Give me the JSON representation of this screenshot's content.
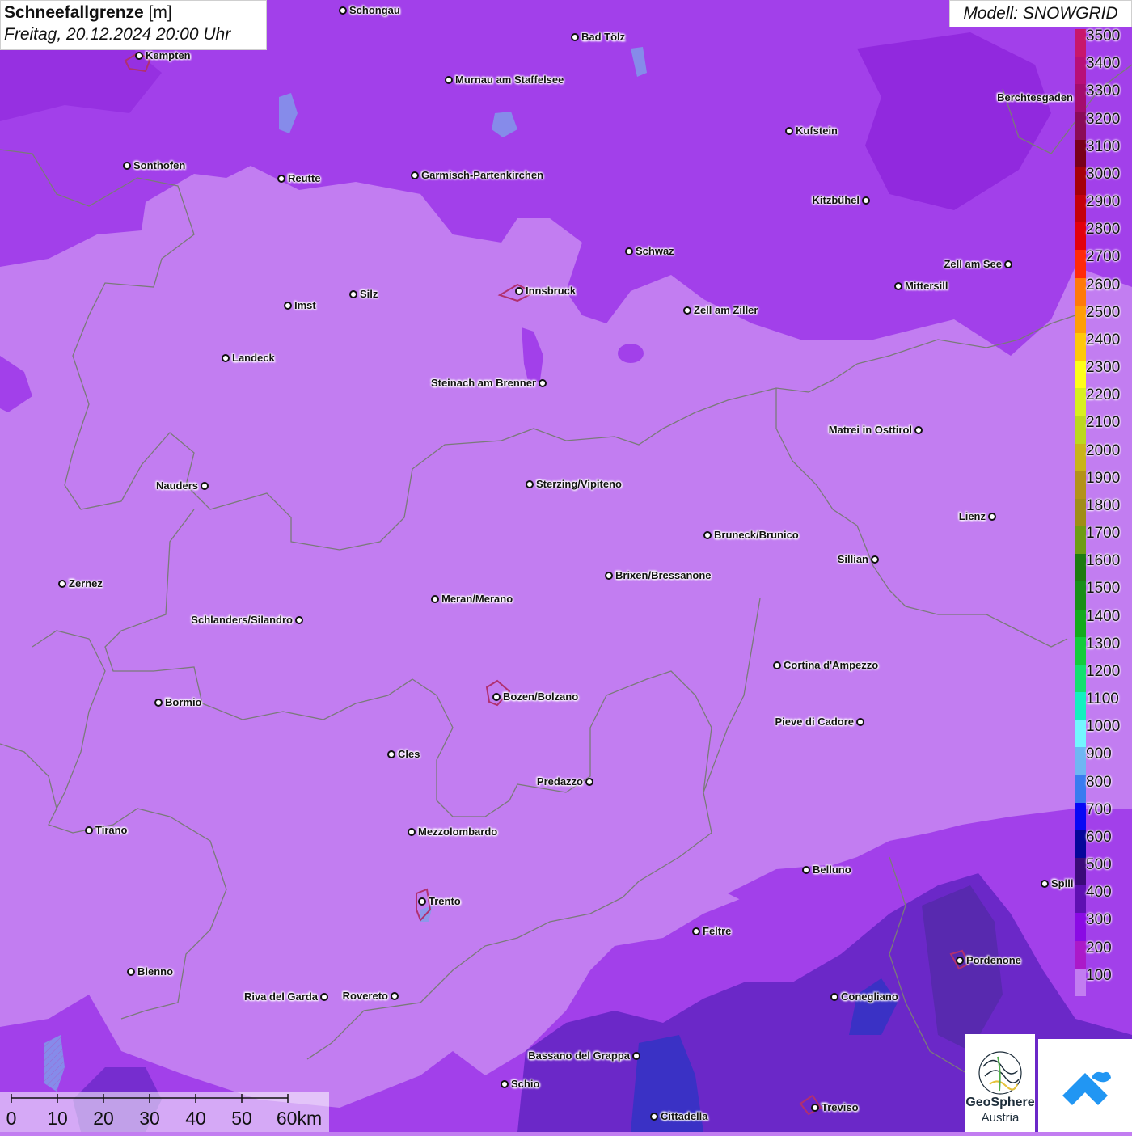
{
  "title": {
    "main": "Schneefallgrenze",
    "unit": "[m]",
    "datetime": "Freitag, 20.12.2024 20:00 Uhr"
  },
  "model_label": "Modell: SNOWGRID",
  "colors": {
    "light_purple": "#c27df1",
    "mid_purple": "#a240ea",
    "dark_purple": "#8a1fd8",
    "blue_purple": "#6b28c8",
    "deep_blue": "#3a31c5",
    "border_gray": "#7a7a7a",
    "lake_blue": "#7f9dea"
  },
  "legend": {
    "labels": [
      "3500",
      "3400",
      "3300",
      "3200",
      "3100",
      "3000",
      "2900",
      "2800",
      "2700",
      "2600",
      "2500",
      "2400",
      "2300",
      "2200",
      "2100",
      "2000",
      "1900",
      "1800",
      "1700",
      "1600",
      "1500",
      "1400",
      "1300",
      "1200",
      "1100",
      "1000",
      "900",
      "800",
      "700",
      "600",
      "500",
      "400",
      "300",
      "200",
      "100"
    ],
    "colors": [
      "#c8176b",
      "#b80f78",
      "#a40c6e",
      "#8a0b58",
      "#78001a",
      "#a5000a",
      "#c4000c",
      "#e2000e",
      "#ff2a0a",
      "#ff7a0a",
      "#ff9e08",
      "#ffc80a",
      "#ffff1a",
      "#d8f020",
      "#bcd820",
      "#c9b41a",
      "#b3921a",
      "#a08d18",
      "#6e9c14",
      "#1e7a10",
      "#1a8e18",
      "#14aa1c",
      "#14cc3c",
      "#14e070",
      "#14f0c0",
      "#74f6ff",
      "#6fb6f3",
      "#3a7bf0",
      "#0808f5",
      "#06069a",
      "#3a0a78",
      "#5e10b2",
      "#8a0ae4",
      "#ab19c9",
      "#c27df1"
    ]
  },
  "cities": [
    {
      "name": "Schongau",
      "side": "right"
    },
    {
      "name": "Bad Tölz",
      "side": "right"
    },
    {
      "name": "Kempten",
      "side": "right"
    },
    {
      "name": "Murnau am Staffelsee",
      "side": "right"
    },
    {
      "name": "Berchtesgaden",
      "side": "left"
    },
    {
      "name": "Kufstein",
      "side": "right"
    },
    {
      "name": "Sonthofen",
      "side": "right"
    },
    {
      "name": "Reutte",
      "side": "right"
    },
    {
      "name": "Garmisch-Partenkirchen",
      "side": "right"
    },
    {
      "name": "Kitzbühel",
      "side": "left"
    },
    {
      "name": "Schwaz",
      "side": "right"
    },
    {
      "name": "Zell am See",
      "side": "left"
    },
    {
      "name": "Innsbruck",
      "side": "right"
    },
    {
      "name": "Mittersill",
      "side": "right"
    },
    {
      "name": "Silz",
      "side": "right"
    },
    {
      "name": "Imst",
      "side": "right"
    },
    {
      "name": "Zell am Ziller",
      "side": "right"
    },
    {
      "name": "Landeck",
      "side": "right"
    },
    {
      "name": "Steinach am Brenner",
      "side": "left"
    },
    {
      "name": "Matrei in Osttirol",
      "side": "left"
    },
    {
      "name": "Nauders",
      "side": "left"
    },
    {
      "name": "Sterzing/Vipiteno",
      "side": "right"
    },
    {
      "name": "Lienz",
      "side": "left"
    },
    {
      "name": "Bruneck/Brunico",
      "side": "right"
    },
    {
      "name": "Sillian",
      "side": "left"
    },
    {
      "name": "Brixen/Bressanone",
      "side": "right"
    },
    {
      "name": "Zernez",
      "side": "right"
    },
    {
      "name": "Meran/Merano",
      "side": "right"
    },
    {
      "name": "Schlanders/Silandro",
      "side": "left"
    },
    {
      "name": "Cortina d'Ampezzo",
      "side": "right"
    },
    {
      "name": "Bozen/Bolzano",
      "side": "right"
    },
    {
      "name": "Bormio",
      "side": "right"
    },
    {
      "name": "Pieve di Cadore",
      "side": "left"
    },
    {
      "name": "Cles",
      "side": "right"
    },
    {
      "name": "Predazzo",
      "side": "left"
    },
    {
      "name": "Tirano",
      "side": "right"
    },
    {
      "name": "Mezzolombardo",
      "side": "right"
    },
    {
      "name": "Belluno",
      "side": "right"
    },
    {
      "name": "Spili",
      "side": "right"
    },
    {
      "name": "Trento",
      "side": "right"
    },
    {
      "name": "Feltre",
      "side": "right"
    },
    {
      "name": "Pordenone",
      "side": "right"
    },
    {
      "name": "Bienno",
      "side": "right"
    },
    {
      "name": "Riva del Garda",
      "side": "left"
    },
    {
      "name": "Rovereto",
      "side": "left"
    },
    {
      "name": "Conegliano",
      "side": "right"
    },
    {
      "name": "Bassano del Grappa",
      "side": "left"
    },
    {
      "name": "Schio",
      "side": "right"
    },
    {
      "name": "Treviso",
      "side": "right"
    },
    {
      "name": "Cittadella",
      "side": "right"
    }
  ],
  "scale_bar": {
    "labels": [
      "0",
      "10",
      "20",
      "30",
      "40",
      "50",
      "60km"
    ]
  },
  "logo": {
    "name": "GeoSphere",
    "sub": "Austria"
  }
}
